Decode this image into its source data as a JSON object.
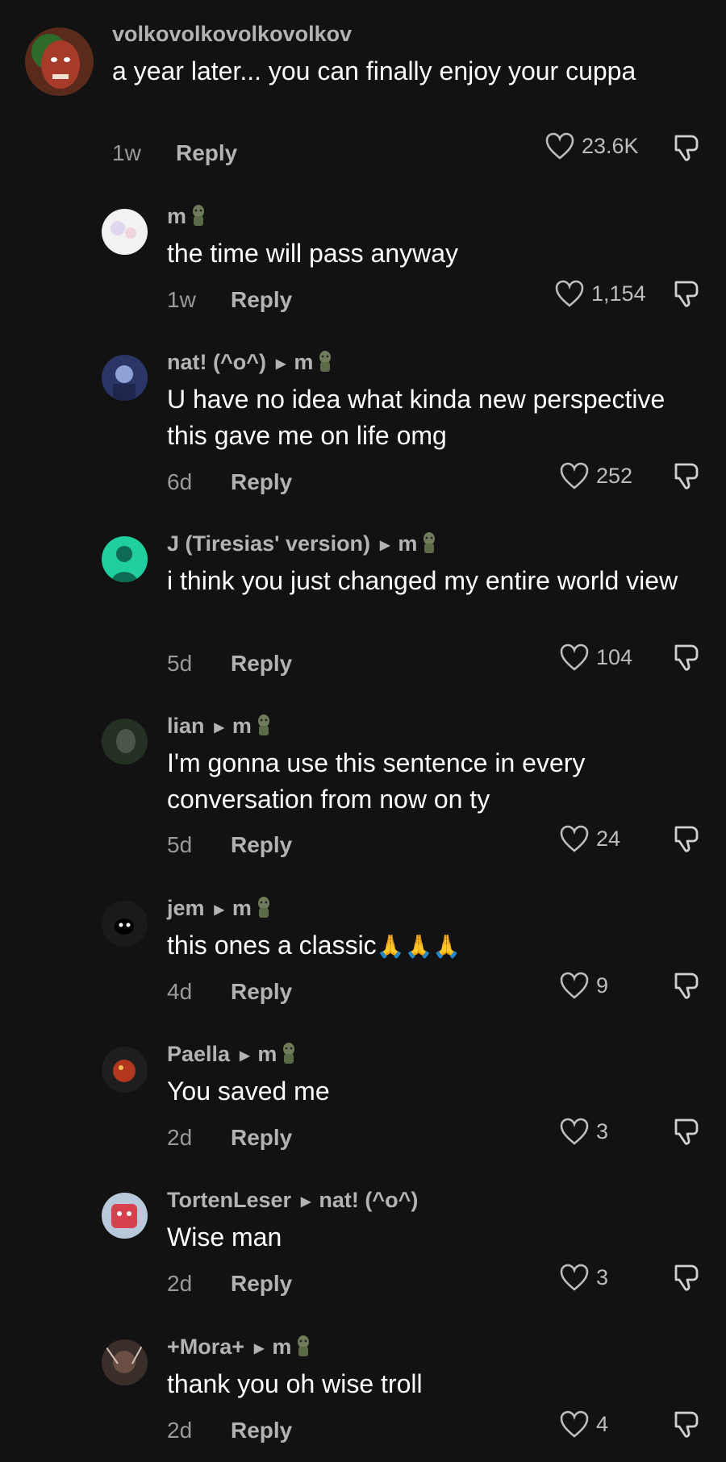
{
  "comments": [
    {
      "username": "volkovolkovolkovolkov",
      "reply_to": "",
      "text": "a year later... you can finally enjoy your cuppa",
      "time": "1w",
      "reply_label": "Reply",
      "likes": "23.6K",
      "avatar_color": "#8a2a22"
    },
    {
      "username": "m",
      "reply_to": "",
      "text": "the time will pass anyway",
      "time": "1w",
      "reply_label": "Reply",
      "likes": "1,154",
      "avatar_color": "#e8e8ee"
    },
    {
      "username": "nat! (^o^)",
      "reply_to": "m",
      "text": "U have no idea what kinda new perspective this gave me on life omg",
      "time": "6d",
      "reply_label": "Reply",
      "likes": "252",
      "avatar_color": "#3b4f8c"
    },
    {
      "username": "J (Tiresias' version)",
      "reply_to": "m",
      "text": "i think you just changed my entire world view",
      "time": "5d",
      "reply_label": "Reply",
      "likes": "104",
      "avatar_color": "#27d3a6"
    },
    {
      "username": "lian",
      "reply_to": "m",
      "text": "I'm gonna use this sentence in every conversation from now on ty",
      "time": "5d",
      "reply_label": "Reply",
      "likes": "24",
      "avatar_color": "#2d332d"
    },
    {
      "username": "jem",
      "reply_to": "m",
      "text": "this ones a classic",
      "emoji": "🙏🙏🙏",
      "time": "4d",
      "reply_label": "Reply",
      "likes": "9",
      "avatar_color": "#1d1d1d"
    },
    {
      "username": "Paella",
      "reply_to": "m",
      "text": "You saved me",
      "time": "2d",
      "reply_label": "Reply",
      "likes": "3",
      "avatar_color": "#a83320"
    },
    {
      "username": "TortenLeser",
      "reply_to": "nat! (^o^)",
      "text": "Wise man",
      "time": "2d",
      "reply_label": "Reply",
      "likes": "3",
      "avatar_color": "#d84a5a"
    },
    {
      "username": "+Mora+",
      "reply_to": "m",
      "text": "thank you oh wise troll",
      "time": "2d",
      "reply_label": "Reply",
      "likes": "4",
      "avatar_color": "#4a3a35"
    }
  ],
  "icons": {
    "like": "heart-outline-icon",
    "dislike": "thumbs-down-icon",
    "reply_arrow": "triangle-right-icon",
    "troll_badge": "troll-emoji-icon"
  }
}
